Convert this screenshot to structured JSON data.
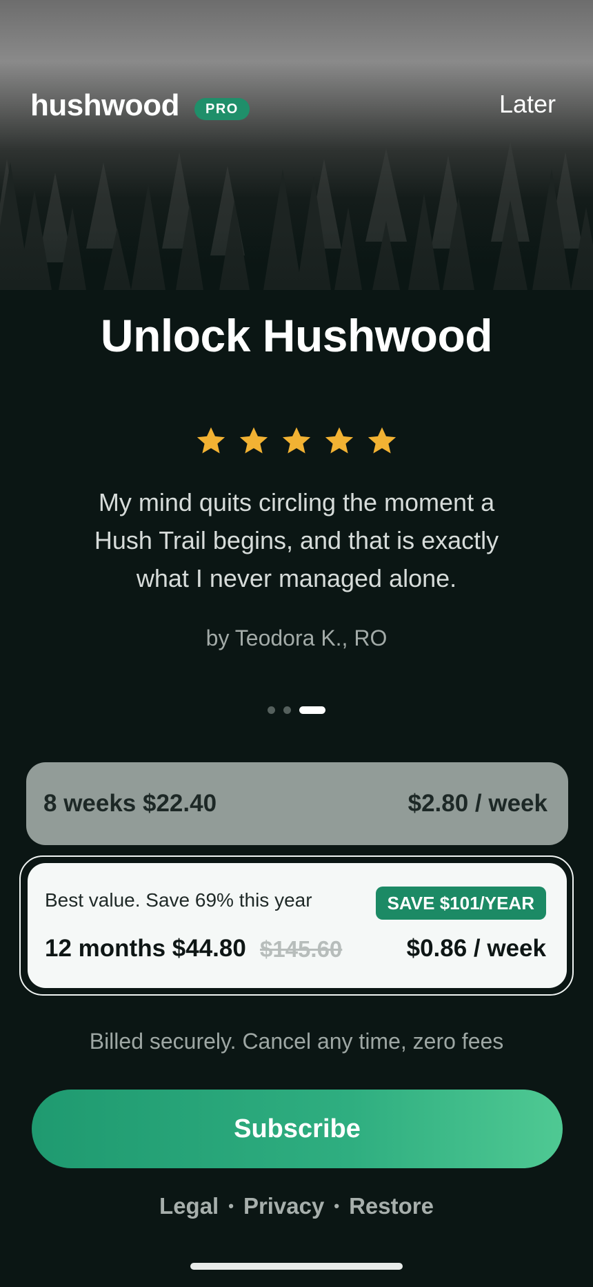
{
  "header": {
    "brand": "hushwood",
    "badge": "PRO",
    "later_label": "Later"
  },
  "hero": {
    "title": "Unlock Hushwood"
  },
  "review": {
    "rating": 5,
    "rating_max": 5,
    "star_color": "#f2b233",
    "quote": "My mind quits circling the moment a Hush Trail begins, and that is exactly what I never managed alone.",
    "author": "by Teodora K., RO"
  },
  "carousel": {
    "page_count": 3,
    "active_index": 2
  },
  "plans": {
    "weekly": {
      "label": "8 weeks $22.40",
      "per_week": "$2.80 / week"
    },
    "yearly": {
      "tagline": "Best value. Save 69% this year",
      "badge": "SAVE $101/YEAR",
      "label": "12 months $44.80",
      "original_price": "$145.60",
      "per_week": "$0.86 / week",
      "selected": true
    }
  },
  "billing_note": "Billed securely. Cancel any time, zero fees",
  "subscribe_label": "Subscribe",
  "footer": {
    "legal": "Legal",
    "privacy": "Privacy",
    "restore": "Restore",
    "separator": "•"
  },
  "colors": {
    "accent": "#1f9a70",
    "background": "#0b1614"
  }
}
